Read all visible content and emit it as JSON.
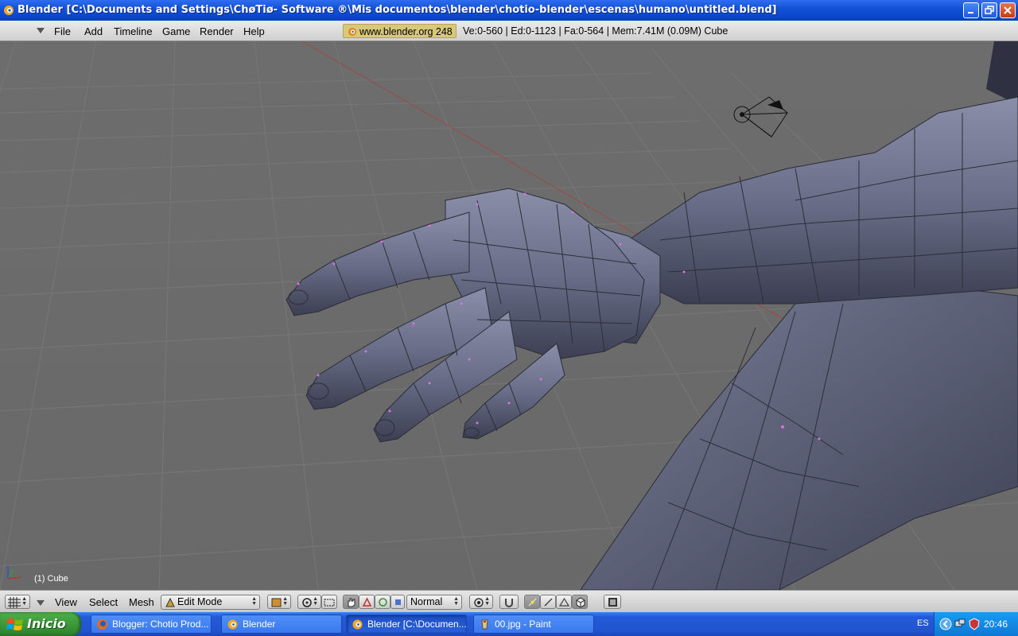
{
  "window": {
    "title": "Blender [C:\\Documents and Settings\\ChøTiø- Software ®\\Mis documentos\\blender\\chotio-blender\\escenas\\humano\\untitled.blend]"
  },
  "menu": {
    "items": [
      "File",
      "Add",
      "Timeline",
      "Game",
      "Render",
      "Help"
    ]
  },
  "info": {
    "url": "www.blender.org 248",
    "stats": "Ve:0-560 | Ed:0-1123 | Fa:0-564 | Mem:7.41M (0.09M) Cube"
  },
  "viewport": {
    "object_label": "(1) Cube"
  },
  "view_header": {
    "view": "View",
    "select": "Select",
    "mesh": "Mesh",
    "mode": "Edit Mode",
    "pivot": "Normal"
  },
  "taskbar": {
    "start": "Inicio",
    "tasks": [
      "Blogger: Chotio Prod...",
      "Blender",
      "Blender [C:\\Documen...",
      "00.jpg - Paint"
    ],
    "lang": "ES",
    "clock": "20:46"
  },
  "colors": {
    "viewport_bg": "#6b6b6b",
    "mesh": "#6f7390",
    "titlebar": "#0a46cf",
    "url_badge": "#d8c87a"
  }
}
